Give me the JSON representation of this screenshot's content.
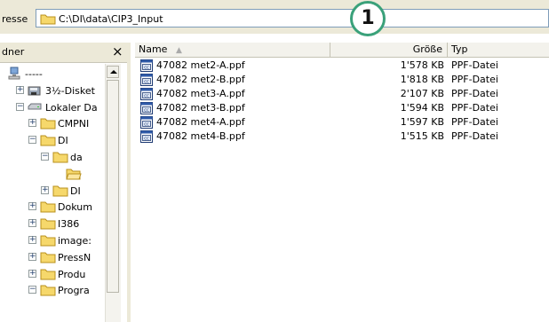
{
  "address": {
    "label": "resse",
    "path": "C:\\DI\\data\\CIP3_Input"
  },
  "callout": "1",
  "folder_pane": {
    "title": "dner",
    "close": "×",
    "tree": [
      {
        "label": "-----",
        "icon": "network-icon",
        "expander": "",
        "indent": 0
      },
      {
        "label": "3½-Disket",
        "icon": "floppy-icon",
        "expander": "+",
        "indent": 1
      },
      {
        "label": "Lokaler Da",
        "icon": "drive-icon",
        "expander": "−",
        "indent": 1
      },
      {
        "label": "CMPNI",
        "icon": "folder-icon",
        "expander": "+",
        "indent": 2
      },
      {
        "label": "DI",
        "icon": "folder-icon",
        "expander": "−",
        "indent": 2
      },
      {
        "label": "da",
        "icon": "folder-icon",
        "expander": "−",
        "indent": 3
      },
      {
        "label": "",
        "icon": "folder-open-icon",
        "expander": "",
        "indent": 4
      },
      {
        "label": "DI",
        "icon": "folder-icon",
        "expander": "+",
        "indent": 3
      },
      {
        "label": "Dokum",
        "icon": "folder-icon",
        "expander": "+",
        "indent": 2
      },
      {
        "label": "I386",
        "icon": "folder-icon",
        "expander": "+",
        "indent": 2
      },
      {
        "label": "image:",
        "icon": "folder-icon",
        "expander": "+",
        "indent": 2
      },
      {
        "label": "PressN",
        "icon": "folder-icon",
        "expander": "+",
        "indent": 2
      },
      {
        "label": "Produ",
        "icon": "folder-icon",
        "expander": "+",
        "indent": 2
      },
      {
        "label": "Progra",
        "icon": "folder-icon",
        "expander": "−",
        "indent": 2
      }
    ]
  },
  "file_list": {
    "columns": {
      "name": "Name",
      "size": "Größe",
      "type": "Typ"
    },
    "files": [
      {
        "name": "47082 met2-A.ppf",
        "size": "1'578 KB",
        "type": "PPF-Datei"
      },
      {
        "name": "47082 met2-B.ppf",
        "size": "1'818 KB",
        "type": "PPF-Datei"
      },
      {
        "name": "47082 met3-A.ppf",
        "size": "2'107 KB",
        "type": "PPF-Datei"
      },
      {
        "name": "47082 met3-B.ppf",
        "size": "1'594 KB",
        "type": "PPF-Datei"
      },
      {
        "name": "47082 met4-A.ppf",
        "size": "1'597 KB",
        "type": "PPF-Datei"
      },
      {
        "name": "47082 met4-B.ppf",
        "size": "1'515 KB",
        "type": "PPF-Datei"
      }
    ]
  },
  "colors": {
    "chrome": "#ece9d8",
    "folder": "#f6d86b",
    "callout_ring": "#3aa17a"
  }
}
